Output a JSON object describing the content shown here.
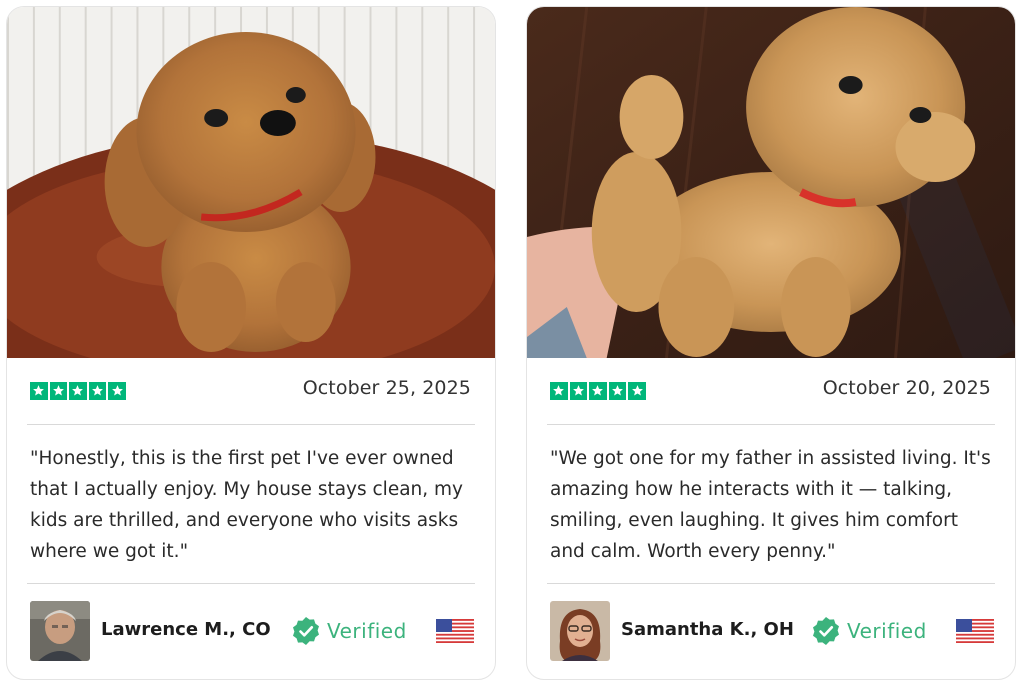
{
  "colors": {
    "star_green": "#00b67a",
    "verified_green": "#3cb37d",
    "border": "#e4e4e4"
  },
  "reviews": [
    {
      "image": "plush-toy-dog-on-table-photo",
      "rating": 5,
      "date": "October 25, 2025",
      "quote": "\"Honestly, this is the first pet I've ever owned that I actually enjoy. My house stays clean, my kids are thrilled, and everyone who visits asks where we got it.\"",
      "reviewer": "Lawrence M., CO",
      "verified_label": "Verified",
      "flag": "us-flag-icon"
    },
    {
      "image": "plush-toy-dog-held-in-hand-photo",
      "rating": 5,
      "date": "October 20, 2025",
      "quote": "\"We got one for my father in assisted living. It's amazing how he interacts with it — talking, smiling, even laughing. It gives him comfort and calm. Worth every penny.\"",
      "reviewer": "Samantha K., OH",
      "verified_label": "Verified",
      "flag": "us-flag-icon"
    }
  ]
}
